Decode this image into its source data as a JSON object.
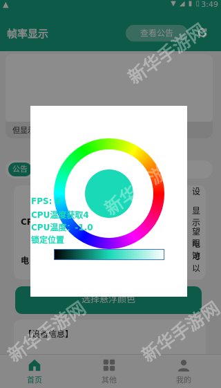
{
  "status_bar": {
    "warning_glyph": "▲",
    "icons": "▼ ◢ ▮ ▯",
    "time": "3:49"
  },
  "header": {
    "title": "帧率显示",
    "notice_button": "查看公告",
    "refresh_icon": "refresh-icon"
  },
  "preview": {
    "label": "但显示"
  },
  "notice": {
    "badge": "公告"
  },
  "settings": {
    "cpu_label": "CP",
    "elec_label": "电",
    "side_lines": [
      "设",
      "显示",
      "望限",
      "电池",
      "可以"
    ]
  },
  "choose_button": "选择悬浮颜色",
  "device_info": {
    "title": "【设备信息】"
  },
  "float_overlay": {
    "fps": "FPS: 6",
    "cpu_temp_read": "CPU温度获取4",
    "cpu_temp": "CPU温度：-1.0",
    "lock": "锁定位置"
  },
  "color_picker": {
    "selected_color": "#19d9b6"
  },
  "bottom_nav": [
    {
      "label": "首页",
      "icon": "home-icon",
      "active": true
    },
    {
      "label": "其他",
      "icon": "grid-icon",
      "active": false
    },
    {
      "label": "我的",
      "icon": "user-icon",
      "active": false
    }
  ],
  "watermark": "新华手游网",
  "colors": {
    "accent": "#1aa583",
    "picker_color": "#19d9b6"
  }
}
